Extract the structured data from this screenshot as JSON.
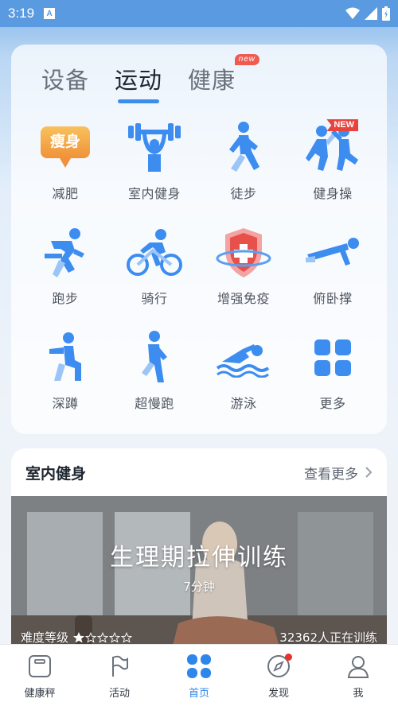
{
  "status_bar": {
    "time": "3:19",
    "notification_icon": "A"
  },
  "tabs": [
    {
      "label": "设备",
      "active": false,
      "badge": ""
    },
    {
      "label": "运动",
      "active": true,
      "badge": ""
    },
    {
      "label": "健康",
      "active": false,
      "badge": "new"
    }
  ],
  "sports": [
    {
      "label": "减肥",
      "icon": "weight-loss-icon",
      "badge": "",
      "icon_text": "瘦身"
    },
    {
      "label": "室内健身",
      "icon": "dumbbell-lift-icon",
      "badge": ""
    },
    {
      "label": "徒步",
      "icon": "walking-icon",
      "badge": ""
    },
    {
      "label": "健身操",
      "icon": "aerobics-icon",
      "badge": "NEW"
    },
    {
      "label": "跑步",
      "icon": "running-icon",
      "badge": ""
    },
    {
      "label": "骑行",
      "icon": "cycling-icon",
      "badge": ""
    },
    {
      "label": "增强免疫",
      "icon": "immunity-shield-icon",
      "badge": ""
    },
    {
      "label": "俯卧撑",
      "icon": "pushup-icon",
      "badge": ""
    },
    {
      "label": "深蹲",
      "icon": "squat-icon",
      "badge": ""
    },
    {
      "label": "超慢跑",
      "icon": "slow-jog-icon",
      "badge": ""
    },
    {
      "label": "游泳",
      "icon": "swimming-icon",
      "badge": ""
    },
    {
      "label": "更多",
      "icon": "more-grid-icon",
      "badge": ""
    }
  ],
  "fitness_section": {
    "title": "室内健身",
    "see_more": "查看更多",
    "banner": {
      "title": "生理期拉伸训练",
      "duration": "7分钟",
      "difficulty_label": "难度等级",
      "difficulty_stars": 1,
      "difficulty_max": 5,
      "trainees": "32362人正在训练"
    }
  },
  "bottom_nav": [
    {
      "label": "健康秤",
      "icon": "scale-icon",
      "active": false
    },
    {
      "label": "活动",
      "icon": "flag-icon",
      "active": false
    },
    {
      "label": "首页",
      "icon": "home-icon",
      "active": true
    },
    {
      "label": "发现",
      "icon": "compass-icon",
      "active": false,
      "dot": true
    },
    {
      "label": "我",
      "icon": "profile-icon",
      "active": false
    }
  ],
  "colors": {
    "accent": "#3b8fec",
    "badge_red": "#e6443c",
    "icon_blue": "#3d8cf0"
  }
}
